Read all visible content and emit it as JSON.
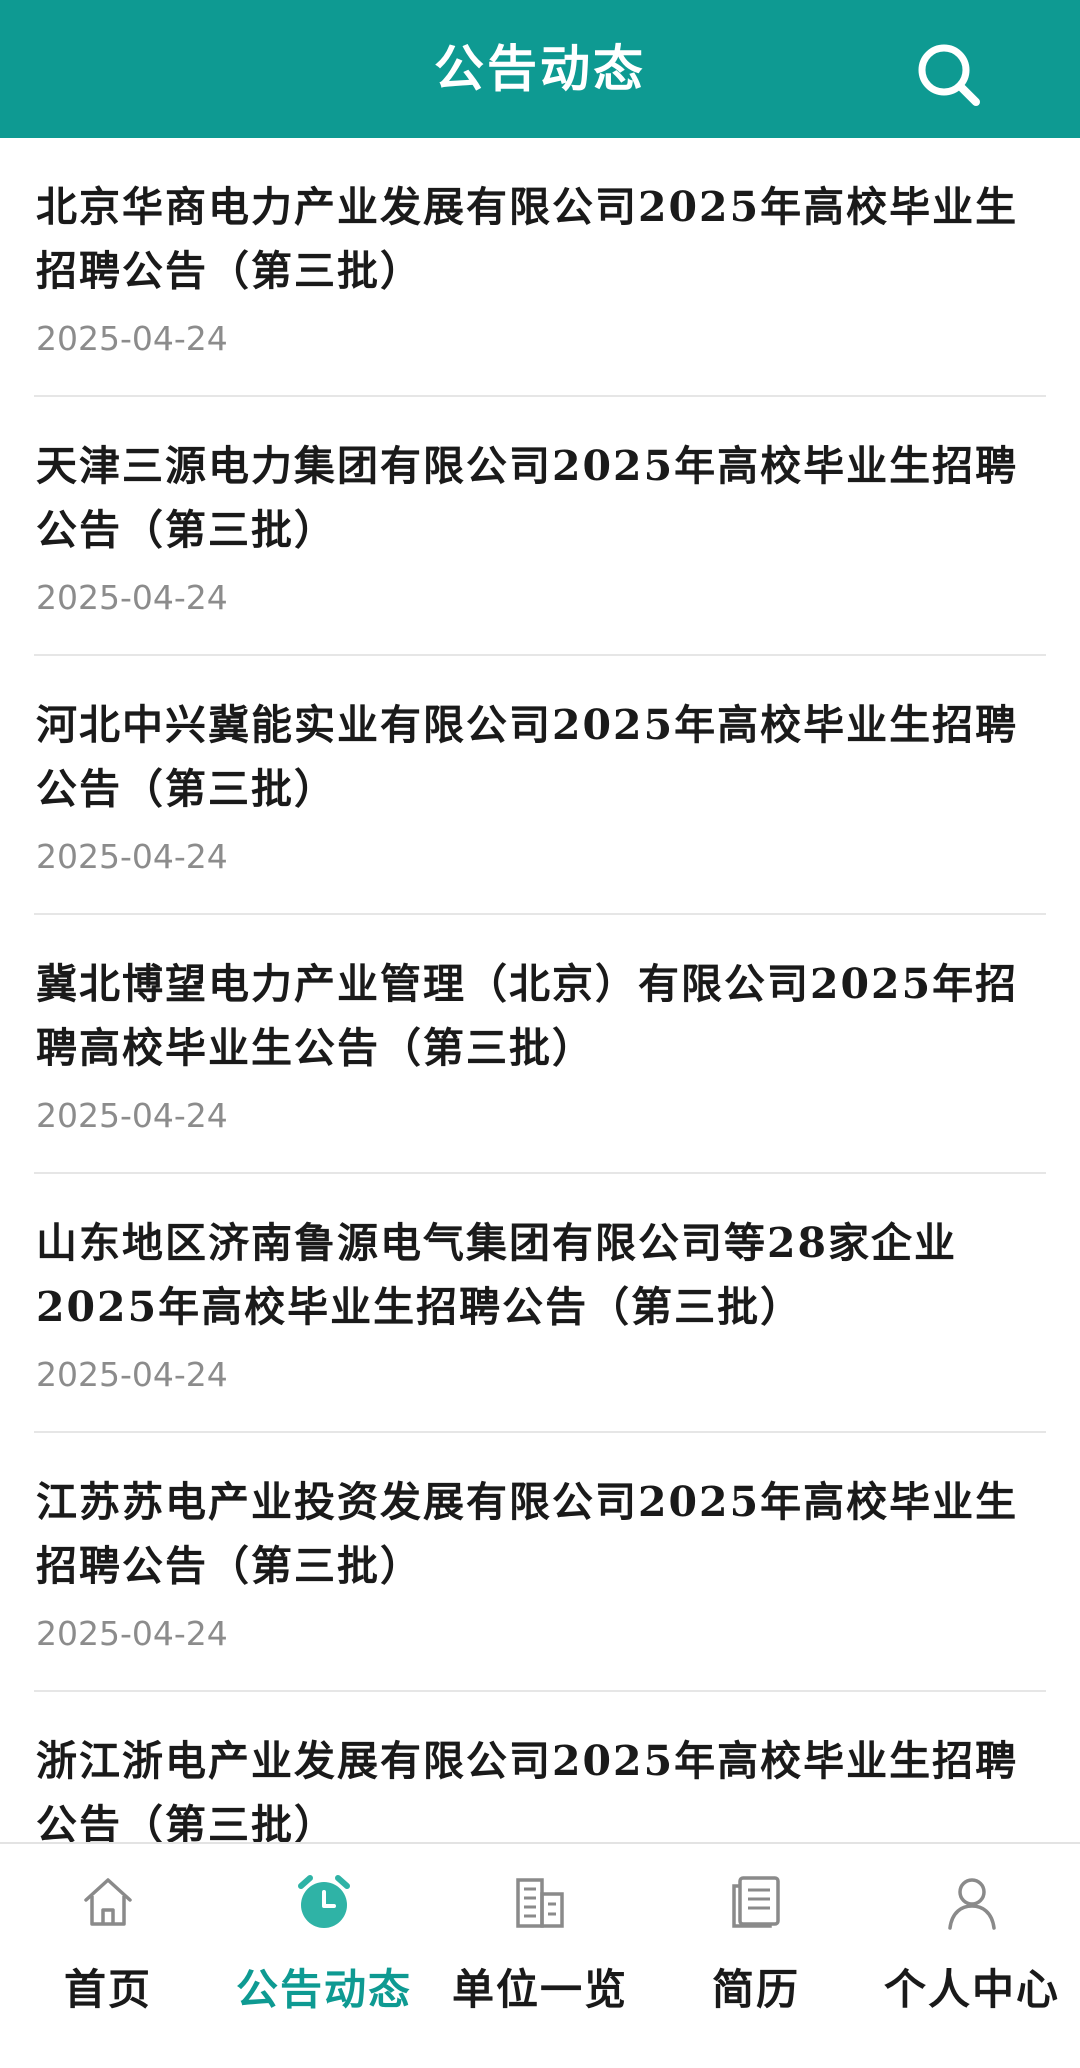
{
  "header": {
    "title": "公告动态",
    "search_icon": "search-icon"
  },
  "announcements": [
    {
      "title": "北京华商电力产业发展有限公司2025年高校毕业生招聘公告（第三批）",
      "date": "2025-04-24"
    },
    {
      "title": "天津三源电力集团有限公司2025年高校毕业生招聘公告（第三批）",
      "date": "2025-04-24"
    },
    {
      "title": "河北中兴冀能实业有限公司2025年高校毕业生招聘公告（第三批）",
      "date": "2025-04-24"
    },
    {
      "title": "冀北博望电力产业管理（北京）有限公司2025年招聘高校毕业生公告（第三批）",
      "date": "2025-04-24"
    },
    {
      "title": "山东地区济南鲁源电气集团有限公司等28家企业2025年高校毕业生招聘公告（第三批）",
      "date": "2025-04-24"
    },
    {
      "title": "江苏苏电产业投资发展有限公司2025年高校毕业生招聘公告（第三批）",
      "date": "2025-04-24"
    },
    {
      "title": "浙江浙电产业发展有限公司2025年高校毕业生招聘公告（第三批）",
      "date": ""
    }
  ],
  "tabbar": {
    "active_color": "#0e9a92",
    "tabs": [
      {
        "label": "首页",
        "icon": "home-icon",
        "active": false
      },
      {
        "label": "公告动态",
        "icon": "alarm-clock-icon",
        "active": true
      },
      {
        "label": "单位一览",
        "icon": "building-icon",
        "active": false
      },
      {
        "label": "简历",
        "icon": "document-icon",
        "active": false
      },
      {
        "label": "个人中心",
        "icon": "person-icon",
        "active": false
      }
    ]
  }
}
